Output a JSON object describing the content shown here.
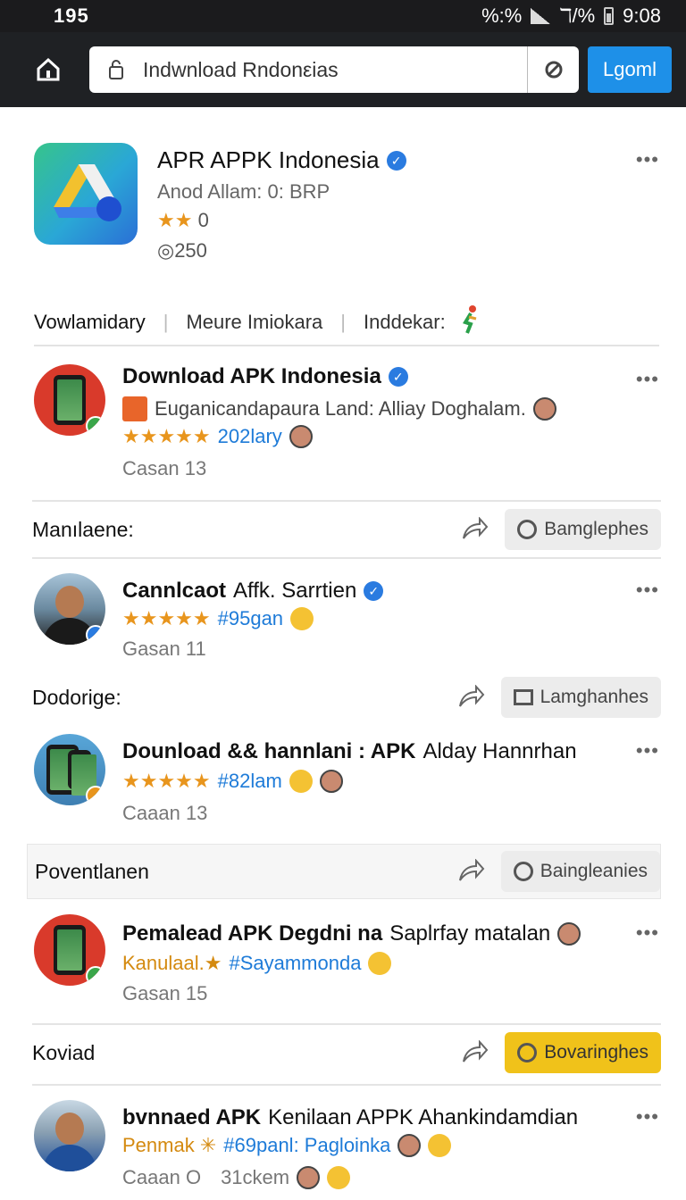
{
  "status_bar": {
    "left": "195",
    "net": "%:%",
    "net2": "ℸ/%",
    "time": "9:08"
  },
  "toolbar": {
    "url": "Indwnload Rndonεias",
    "login_label": "Lgoml"
  },
  "app": {
    "title": "APR APPK Indonesia",
    "subtitle": "Anod Allam: 0: BRP",
    "stars": "★★",
    "rating": "0",
    "downloads": "◎250"
  },
  "tabs": [
    {
      "label": "Vowlamidary"
    },
    {
      "label": "Meure Imiokara"
    },
    {
      "label": "Inddekar:"
    }
  ],
  "items": [
    {
      "title": "Download APK Indonesia",
      "title_rest": "",
      "line2": "Euganicandapaura Land: Alliay Doghalam.",
      "stars": "★★★★★",
      "tag": "202lary",
      "meta": "Casan 13",
      "meta2": ""
    },
    {
      "title": "Cannlcaot",
      "title_rest": "Affk. Sarrtien",
      "line2": "",
      "stars": "★★★★★",
      "tag": "#95gan",
      "meta": "Gasan 11",
      "meta2": ""
    },
    {
      "title": "Dounload && hannlani : APK",
      "title_rest": "Alday Hannrhan",
      "line2": "",
      "stars": "★★★★★",
      "tag": "#82lam",
      "meta": "Caaan 13",
      "meta2": ""
    },
    {
      "title": "Pemalead APK Degdni na",
      "title_rest": "Saplrfay matalan",
      "line2": "",
      "stars": "Kanulaal.★",
      "tag": "#Sayammonda",
      "meta": "Gasan 15",
      "meta2": ""
    },
    {
      "title": "bvnnaed APK",
      "title_rest": "Kenilaan APPK Ahankindamdian",
      "line2": "",
      "stars": "Penmak ✳",
      "tag": "#69panl: Pagloinka",
      "meta": "Caaan  O",
      "meta2": "31ckem"
    }
  ],
  "sections": [
    {
      "label": "Manılaene:",
      "button": "Bamglephes"
    },
    {
      "label": "Dodorige:",
      "button": "Lamghanhes"
    },
    {
      "label": "Poventlanen",
      "button": "Baingleanies"
    },
    {
      "label": "Koviad",
      "button": "Bovaringhes"
    }
  ],
  "more_label": "•••",
  "colors": {
    "accent": "#1e90e8",
    "star": "#e8951d",
    "gold_button": "#f0c21a",
    "verified": "#2a7be0"
  }
}
